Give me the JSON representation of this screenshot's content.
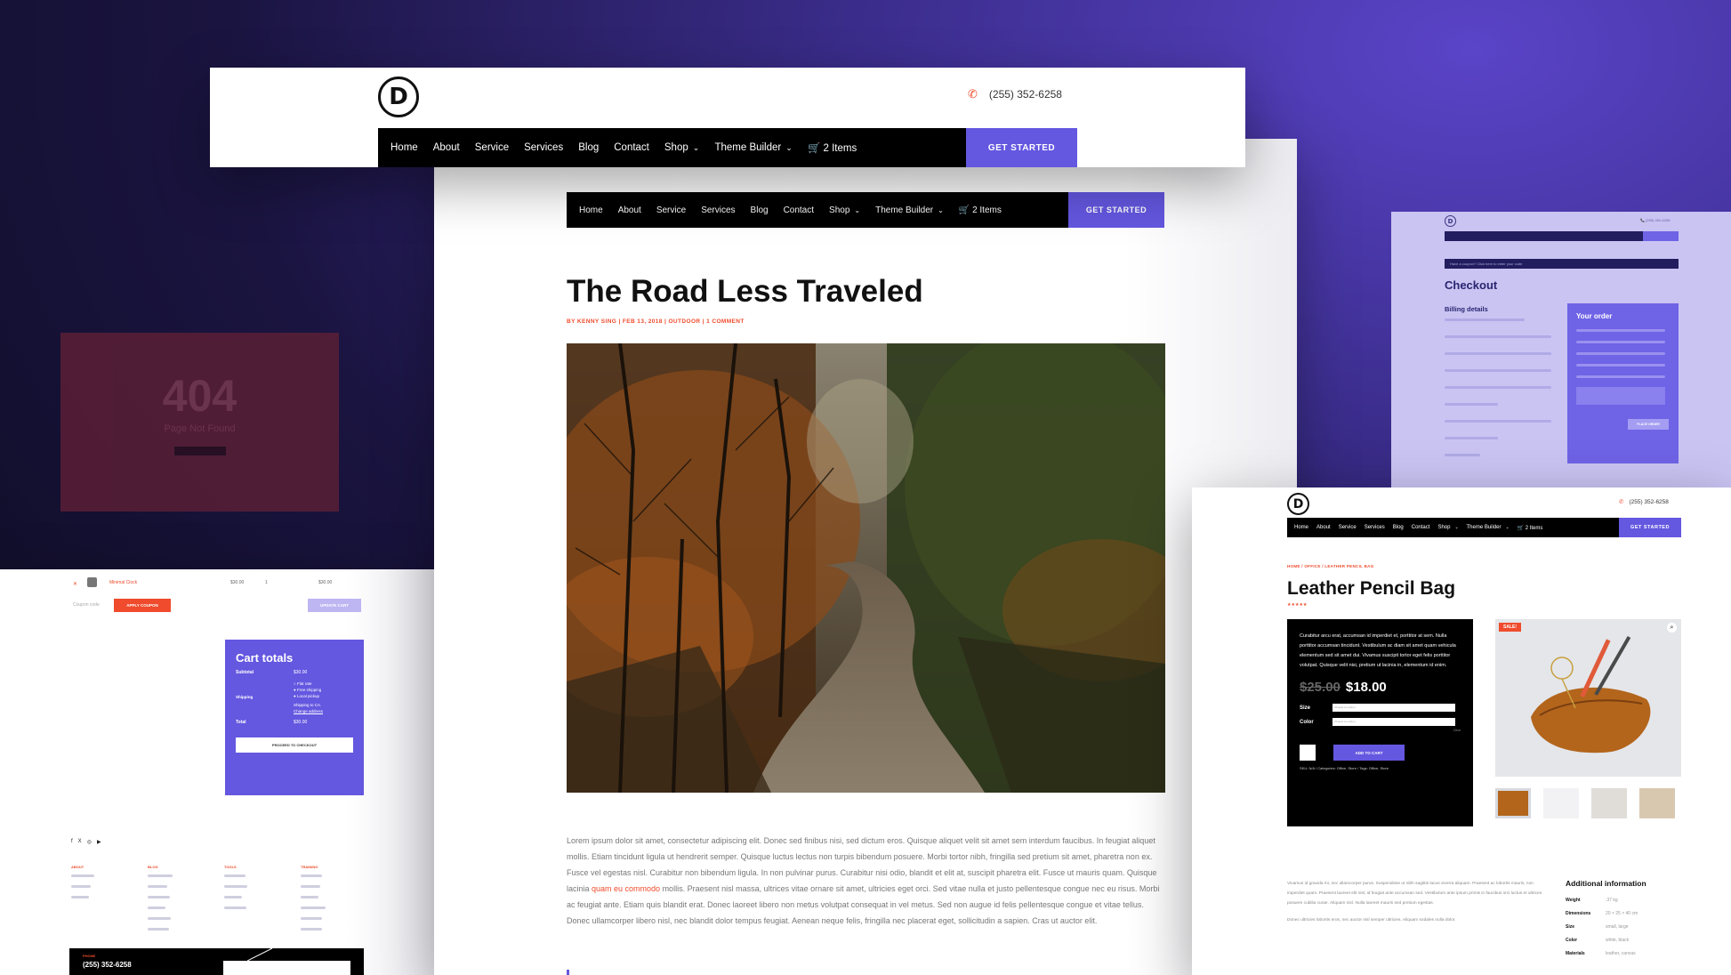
{
  "site": {
    "logo_letter": "D",
    "phone": "(255) 352-6258",
    "nav": [
      "Home",
      "About",
      "Service",
      "Services",
      "Blog",
      "Contact",
      "Shop",
      "Theme Builder"
    ],
    "cart_label": "2 Items",
    "cta": "GET STARTED"
  },
  "error_page": {
    "code": "404",
    "message": "Page Not Found",
    "button": "Back to Homepage"
  },
  "blog_post": {
    "title": "The Road Less Traveled",
    "meta_author": "BY KENNY SING",
    "meta_date": "FEB 13, 2018",
    "meta_category": "OUTDOOR",
    "meta_comments": "1 COMMENT",
    "body_part1": "Lorem ipsum dolor sit amet, consectetur adipiscing elit. Donec sed finibus nisi, sed dictum eros. Quisque aliquet velit sit amet sem interdum faucibus. In feugiat aliquet mollis. Etiam tincidunt ligula ut hendrerit semper. Quisque luctus lectus non turpis bibendum posuere. Morbi tortor nibh, fringilla sed pretium sit amet, pharetra non ex. Fusce vel egestas nisl. Curabitur non bibendum ligula. In non pulvinar purus. Curabitur nisi odio, blandit et elit at, suscipit pharetra elit. Fusce ut mauris quam. Quisque lacinia ",
    "body_link": "quam eu commodo",
    "body_part2": " mollis. Praesent nisl massa, ultrices vitae ornare sit amet, ultricies eget orci. Sed vitae nulla et justo pellentesque congue nec eu risus. Morbi ac feugiat ante. Etiam quis blandit erat. Donec laoreet libero non metus volutpat consequat in vel metus. Sed non augue id felis pellentesque congue et vitae tellus. Donec ullamcorper libero nisl, nec blandit dolor tempus feugiat. Aenean neque felis, fringilla nec placerat eget, sollicitudin a sapien. Cras ut auctor elit."
  },
  "cart_page": {
    "product_name": "Minimal Clock",
    "price": "$30.00",
    "subtotal_row": "$30.00",
    "coupon_placeholder": "Coupon code",
    "apply_coupon": "APPLY COUPON",
    "update_cart": "UPDATE CART",
    "totals_title": "Cart totals",
    "subtotal_label": "Subtotal",
    "subtotal_value": "$30.00",
    "shipping_label": "Shipping",
    "shipping_options": [
      "Flat rate",
      "Free shipping",
      "Local pickup"
    ],
    "shipping_to": "Shipping to CA.",
    "change_address": "Change address",
    "total_label": "Total",
    "total_value": "$30.00",
    "checkout_button": "PROCEED TO CHECKOUT",
    "footer_headings": [
      "ABOUT",
      "BLOG",
      "TOOLS",
      "TRAINING"
    ],
    "footer_phone_label": "PHONE",
    "footer_phone": "(255) 352-6258"
  },
  "checkout_page": {
    "coupon_notice": "Have a coupon? Click here to enter your code",
    "title": "Checkout",
    "billing_title": "Billing details",
    "order_title": "Your order",
    "place_order": "PLACE ORDER"
  },
  "product_page": {
    "breadcrumb": "HOME / OFFICE / LEATHER PENCIL BAG",
    "title": "Leather Pencil Bag",
    "rating": "★★★★★",
    "description": "Curabitur arcu erat, accumsan id imperdiet et, porttitor at sem. Nulla porttitor accumsan tincidunt. Vestibulum ac diam sit amet quam vehicula elementum sed sit amet dui. Vivamus suscipit tortor eget felis porttitor volutpat. Quisque velit nisi, pretium ut lacinia in, elementum id enim.",
    "old_price": "$25.00",
    "price": "$18.00",
    "size_label": "Size",
    "color_label": "Color",
    "select_placeholder": "Choose an option",
    "clear_label": "Clear",
    "add_to_cart": "ADD TO CART",
    "sku_line": "SKU: N/A / Categories: Office, Store / Tags: Office, Store",
    "sale_badge": "SALE!",
    "additional_title": "Additional information",
    "attributes": [
      {
        "name": "Weight",
        "value": ".37 kg"
      },
      {
        "name": "Dimensions",
        "value": "20 × 25 × 40 cm"
      },
      {
        "name": "Size",
        "value": "small, large"
      },
      {
        "name": "Color",
        "value": "white, black"
      },
      {
        "name": "Materials",
        "value": "leather, canvas"
      }
    ],
    "long_desc": "Vivamus id gravida mi, nec ullamcorper purus. Suspendisse ut nibh sagittis lacus viverra aliquam. Praesent ac lobortis mauris, non imperdiet quam. Praesent laoreet elit nisl, id feugiat ante accumsan sed. Vestibulum ante ipsum primis in faucibus orci luctus et ultrices posuere cubilia curae. Aliquam nisl. Nulla laoreet mauris sed pretium egestas.",
    "long_desc2": "Donec ultricies lobortis eros, nec auctor nisl semper ultricies. Aliquam sodales nulla dolor."
  },
  "colors": {
    "accent": "#6457e0",
    "coupon_button": "#ef4b2c",
    "meta": "#ef4b2c",
    "nav_bg": "#000000"
  }
}
